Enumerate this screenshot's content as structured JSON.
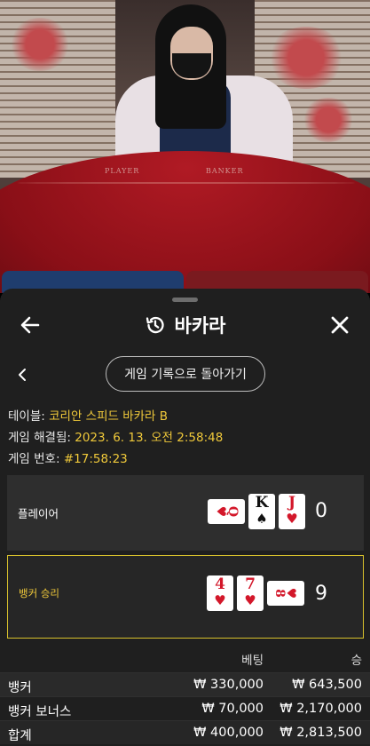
{
  "video": {
    "felt_player_text": "PLAYER",
    "felt_banker_text": "BANKER"
  },
  "modal": {
    "title": "바카라",
    "title_icon": "history-icon",
    "back_icon": "arrow-left-icon",
    "close_icon": "close-icon",
    "prev_icon": "chevron-left-icon",
    "back_to_history_label": "게임 기록으로 돌아가기"
  },
  "info": {
    "table_label": "테이블:",
    "table_value": "코리안 스피드 바카라 B",
    "resolved_label": "게임 해결됨:",
    "resolved_value": "2023. 6. 13. 오전 2:58:48",
    "number_label": "게임 번호:",
    "number_value": "#17:58:23"
  },
  "player": {
    "label": "플레이어",
    "score": "0",
    "cards": [
      {
        "rank": "Q",
        "suit": "♥",
        "color": "red",
        "orientation": "sideways"
      },
      {
        "rank": "K",
        "suit": "♠",
        "color": "black",
        "orientation": "upright"
      },
      {
        "rank": "J",
        "suit": "♥",
        "color": "red",
        "orientation": "upright"
      }
    ]
  },
  "banker": {
    "label": "뱅커 승리",
    "label_color": "#f0c93a",
    "score": "9",
    "cards": [
      {
        "rank": "4",
        "suit": "♥",
        "color": "red",
        "orientation": "upright"
      },
      {
        "rank": "7",
        "suit": "♥",
        "color": "red",
        "orientation": "upright"
      },
      {
        "rank": "8",
        "suit": "♥",
        "color": "red",
        "orientation": "sideways"
      }
    ]
  },
  "bets": {
    "header_bet": "베팅",
    "header_win": "승",
    "rows": [
      {
        "name": "뱅커",
        "bet": "₩ 330,000",
        "win": "₩ 643,500"
      },
      {
        "name": "뱅커 보너스",
        "bet": "₩ 70,000",
        "win": "₩ 2,170,000"
      },
      {
        "name": "합계",
        "bet": "₩ 400,000",
        "win": "₩ 2,813,500"
      }
    ]
  },
  "colors": {
    "accent_gold": "#f0c93a",
    "sheet_bg": "#1f1f1f",
    "card_red": "#d3172a"
  }
}
